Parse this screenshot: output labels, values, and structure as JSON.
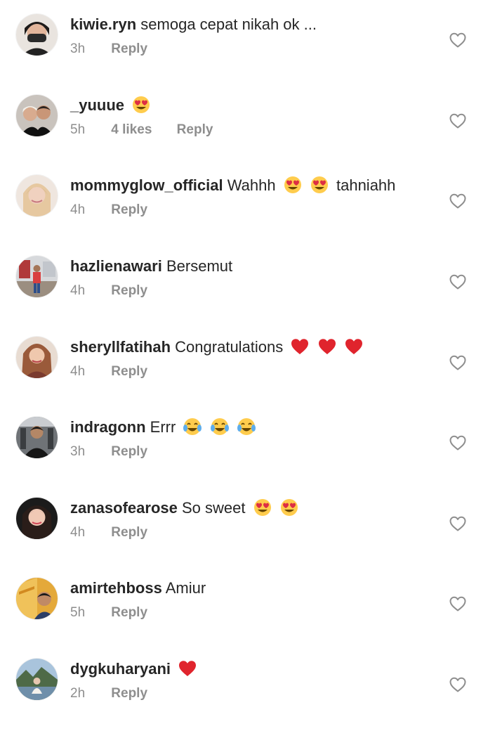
{
  "comments": [
    {
      "username": "kiwie.ryn",
      "text": "semoga cepat nikah ok ...",
      "emojis": [],
      "time": "3h",
      "likes": "",
      "reply_label": "Reply"
    },
    {
      "username": "_yuuue",
      "text": "",
      "emojis": [
        "heart-eyes"
      ],
      "time": "5h",
      "likes": "4 likes",
      "reply_label": "Reply"
    },
    {
      "username": "mommyglow_official",
      "text": "Wahhh",
      "emojis": [
        "heart-eyes",
        "heart-eyes"
      ],
      "text_after": "tahniahh",
      "time": "4h",
      "likes": "",
      "reply_label": "Reply"
    },
    {
      "username": "hazlienawari",
      "text": "Bersemut",
      "emojis": [],
      "time": "4h",
      "likes": "",
      "reply_label": "Reply"
    },
    {
      "username": "sheryllfatihah",
      "text": "Congratulations",
      "emojis": [
        "red-heart",
        "red-heart",
        "red-heart"
      ],
      "time": "4h",
      "likes": "",
      "reply_label": "Reply"
    },
    {
      "username": "indragonn",
      "text": "Errr",
      "emojis": [
        "tears-of-joy",
        "tears-of-joy",
        "tears-of-joy"
      ],
      "time": "3h",
      "likes": "",
      "reply_label": "Reply"
    },
    {
      "username": "zanasofearose",
      "text": "So sweet",
      "emojis": [
        "heart-eyes",
        "heart-eyes"
      ],
      "time": "4h",
      "likes": "",
      "reply_label": "Reply"
    },
    {
      "username": "amirtehboss",
      "text": "Amiur",
      "emojis": [],
      "time": "5h",
      "likes": "",
      "reply_label": "Reply"
    },
    {
      "username": "dygkuharyani",
      "text": "",
      "emojis": [
        "red-heart"
      ],
      "time": "2h",
      "likes": "",
      "reply_label": "Reply"
    }
  ],
  "icons": {
    "like": "heart-outline-icon"
  },
  "colors": {
    "text": "#262626",
    "secondary": "#8e8e8e",
    "like_icon": "#8e8e8e"
  }
}
